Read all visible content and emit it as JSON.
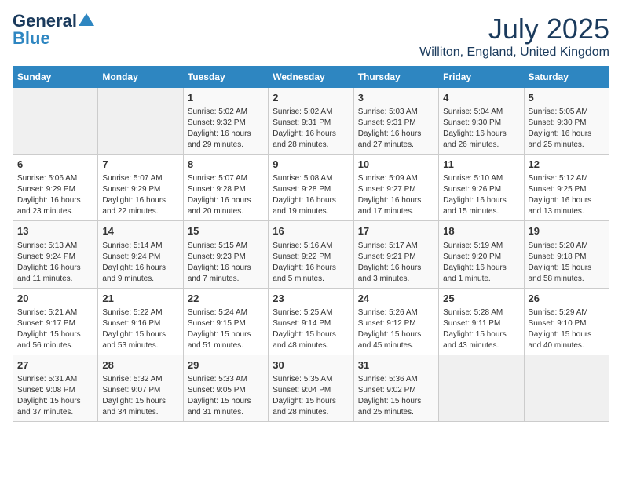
{
  "header": {
    "logo_line1": "General",
    "logo_line2": "Blue",
    "month_year": "July 2025",
    "location": "Williton, England, United Kingdom"
  },
  "days_of_week": [
    "Sunday",
    "Monday",
    "Tuesday",
    "Wednesday",
    "Thursday",
    "Friday",
    "Saturday"
  ],
  "weeks": [
    [
      {
        "day": null,
        "sunrise": null,
        "sunset": null,
        "daylight": null
      },
      {
        "day": null,
        "sunrise": null,
        "sunset": null,
        "daylight": null
      },
      {
        "day": "1",
        "sunrise": "5:02 AM",
        "sunset": "9:32 PM",
        "daylight": "16 hours and 29 minutes."
      },
      {
        "day": "2",
        "sunrise": "5:02 AM",
        "sunset": "9:31 PM",
        "daylight": "16 hours and 28 minutes."
      },
      {
        "day": "3",
        "sunrise": "5:03 AM",
        "sunset": "9:31 PM",
        "daylight": "16 hours and 27 minutes."
      },
      {
        "day": "4",
        "sunrise": "5:04 AM",
        "sunset": "9:30 PM",
        "daylight": "16 hours and 26 minutes."
      },
      {
        "day": "5",
        "sunrise": "5:05 AM",
        "sunset": "9:30 PM",
        "daylight": "16 hours and 25 minutes."
      }
    ],
    [
      {
        "day": "6",
        "sunrise": "5:06 AM",
        "sunset": "9:29 PM",
        "daylight": "16 hours and 23 minutes."
      },
      {
        "day": "7",
        "sunrise": "5:07 AM",
        "sunset": "9:29 PM",
        "daylight": "16 hours and 22 minutes."
      },
      {
        "day": "8",
        "sunrise": "5:07 AM",
        "sunset": "9:28 PM",
        "daylight": "16 hours and 20 minutes."
      },
      {
        "day": "9",
        "sunrise": "5:08 AM",
        "sunset": "9:28 PM",
        "daylight": "16 hours and 19 minutes."
      },
      {
        "day": "10",
        "sunrise": "5:09 AM",
        "sunset": "9:27 PM",
        "daylight": "16 hours and 17 minutes."
      },
      {
        "day": "11",
        "sunrise": "5:10 AM",
        "sunset": "9:26 PM",
        "daylight": "16 hours and 15 minutes."
      },
      {
        "day": "12",
        "sunrise": "5:12 AM",
        "sunset": "9:25 PM",
        "daylight": "16 hours and 13 minutes."
      }
    ],
    [
      {
        "day": "13",
        "sunrise": "5:13 AM",
        "sunset": "9:24 PM",
        "daylight": "16 hours and 11 minutes."
      },
      {
        "day": "14",
        "sunrise": "5:14 AM",
        "sunset": "9:24 PM",
        "daylight": "16 hours and 9 minutes."
      },
      {
        "day": "15",
        "sunrise": "5:15 AM",
        "sunset": "9:23 PM",
        "daylight": "16 hours and 7 minutes."
      },
      {
        "day": "16",
        "sunrise": "5:16 AM",
        "sunset": "9:22 PM",
        "daylight": "16 hours and 5 minutes."
      },
      {
        "day": "17",
        "sunrise": "5:17 AM",
        "sunset": "9:21 PM",
        "daylight": "16 hours and 3 minutes."
      },
      {
        "day": "18",
        "sunrise": "5:19 AM",
        "sunset": "9:20 PM",
        "daylight": "16 hours and 1 minute."
      },
      {
        "day": "19",
        "sunrise": "5:20 AM",
        "sunset": "9:18 PM",
        "daylight": "15 hours and 58 minutes."
      }
    ],
    [
      {
        "day": "20",
        "sunrise": "5:21 AM",
        "sunset": "9:17 PM",
        "daylight": "15 hours and 56 minutes."
      },
      {
        "day": "21",
        "sunrise": "5:22 AM",
        "sunset": "9:16 PM",
        "daylight": "15 hours and 53 minutes."
      },
      {
        "day": "22",
        "sunrise": "5:24 AM",
        "sunset": "9:15 PM",
        "daylight": "15 hours and 51 minutes."
      },
      {
        "day": "23",
        "sunrise": "5:25 AM",
        "sunset": "9:14 PM",
        "daylight": "15 hours and 48 minutes."
      },
      {
        "day": "24",
        "sunrise": "5:26 AM",
        "sunset": "9:12 PM",
        "daylight": "15 hours and 45 minutes."
      },
      {
        "day": "25",
        "sunrise": "5:28 AM",
        "sunset": "9:11 PM",
        "daylight": "15 hours and 43 minutes."
      },
      {
        "day": "26",
        "sunrise": "5:29 AM",
        "sunset": "9:10 PM",
        "daylight": "15 hours and 40 minutes."
      }
    ],
    [
      {
        "day": "27",
        "sunrise": "5:31 AM",
        "sunset": "9:08 PM",
        "daylight": "15 hours and 37 minutes."
      },
      {
        "day": "28",
        "sunrise": "5:32 AM",
        "sunset": "9:07 PM",
        "daylight": "15 hours and 34 minutes."
      },
      {
        "day": "29",
        "sunrise": "5:33 AM",
        "sunset": "9:05 PM",
        "daylight": "15 hours and 31 minutes."
      },
      {
        "day": "30",
        "sunrise": "5:35 AM",
        "sunset": "9:04 PM",
        "daylight": "15 hours and 28 minutes."
      },
      {
        "day": "31",
        "sunrise": "5:36 AM",
        "sunset": "9:02 PM",
        "daylight": "15 hours and 25 minutes."
      },
      {
        "day": null,
        "sunrise": null,
        "sunset": null,
        "daylight": null
      },
      {
        "day": null,
        "sunrise": null,
        "sunset": null,
        "daylight": null
      }
    ]
  ]
}
